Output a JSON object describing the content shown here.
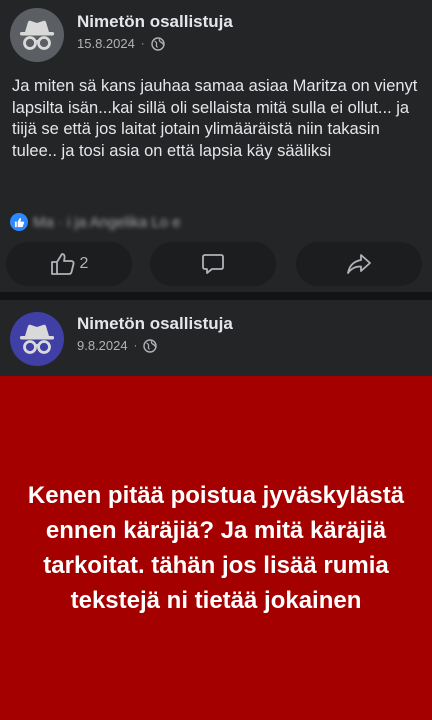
{
  "post1": {
    "author": "Nimetön osallistuja",
    "date": "15.8.2024",
    "separator": "·",
    "privacy_icon": "globe-icon",
    "text": "Ja miten sä kans jauhaa samaa asiaa Maritza on vienyt lapsilta isän...kai sillä oli sellaista mitä sulla ei ollut... ja tiijä se että jos laitat jotain ylimääräistä niin takasin tulee.. ja tosi asia on että lapsia käy sääliksi",
    "reactors": "Ma    ·     i ja Angelika Lo  e",
    "reaction_icon": "like-icon",
    "like_count": "2",
    "actions": {
      "like_icon": "thumbs-up-icon",
      "comment_icon": "comment-icon",
      "share_icon": "share-icon"
    }
  },
  "post2": {
    "author": "Nimetön osallistuja",
    "date": "9.8.2024",
    "separator": "·",
    "privacy_icon": "globe-icon"
  },
  "banner": {
    "text": "Kenen pitää poistua jyväskylästä ennen käräjiä? Ja mitä käräjiä tarkoitat. tähän jos lisää rumia tekstejä ni tietää jokainen"
  },
  "colors": {
    "background": "#242526",
    "accent": "#2d88ff",
    "banner": "#a40000"
  }
}
